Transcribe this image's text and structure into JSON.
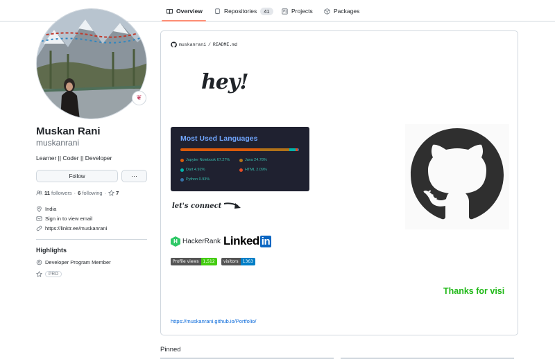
{
  "tabs": [
    {
      "label": "Overview",
      "icon": "book-icon",
      "selected": true
    },
    {
      "label": "Repositories",
      "icon": "repo-icon",
      "count": "41"
    },
    {
      "label": "Projects",
      "icon": "project-icon"
    },
    {
      "label": "Packages",
      "icon": "package-icon"
    }
  ],
  "profile": {
    "name": "Muskan Rani",
    "username": "muskanrani",
    "bio": "Learner || Coder || Developer",
    "follow_label": "Follow",
    "more_label": "···",
    "followers_count": "11",
    "followers_label": "followers",
    "following_count": "6",
    "following_label": "following",
    "stars_count": "7",
    "location": "India",
    "email_label": "Sign in to view email",
    "website": "https://linktr.ee/muskanrani"
  },
  "highlights": {
    "title": "Highlights",
    "items": [
      {
        "label": "Developer Program Member",
        "icon": "cpu-icon"
      },
      {
        "label": "PRO",
        "icon": "star-icon"
      }
    ]
  },
  "readme": {
    "path_user": "muskanrani",
    "path_sep": "/",
    "path_file": "README.md",
    "hey_text": "hey!",
    "connect_text": "let's connect",
    "hackerrank_label": "HackerRank",
    "linkedin_label_main": "Linked",
    "linkedin_label_box": "in",
    "thanks_text": "Thanks for visi",
    "portfolio_url": "https://muskanrani.github.io/Portfolio/"
  },
  "languages_card": {
    "title": "Most Used Languages",
    "items": [
      {
        "label": "Jupyter Notebook 67.27%",
        "color": "#DA5B0B",
        "percent": 67.27
      },
      {
        "label": "Java 24.78%",
        "color": "#b07219",
        "percent": 24.78
      },
      {
        "label": "Dart 4.92%",
        "color": "#00B4AB",
        "percent": 4.92
      },
      {
        "label": "HTML 2.09%",
        "color": "#e34c26",
        "percent": 2.09
      },
      {
        "label": "Python 0.93%",
        "color": "#3572A5",
        "percent": 0.93
      }
    ]
  },
  "badges": {
    "profile_views_label": "Profile views",
    "profile_views_value": "1,512",
    "profile_views_color": "#4c1",
    "visitors_label": "visitors",
    "visitors_value": "1363",
    "visitors_color": "#007ec6"
  },
  "pinned_title": "Pinned",
  "colors": {
    "accent_underline": "#fd8c73",
    "link": "#0969da",
    "thanks": "#1fb816",
    "card_bg": "#1f2130",
    "card_title": "#70a5fd"
  }
}
